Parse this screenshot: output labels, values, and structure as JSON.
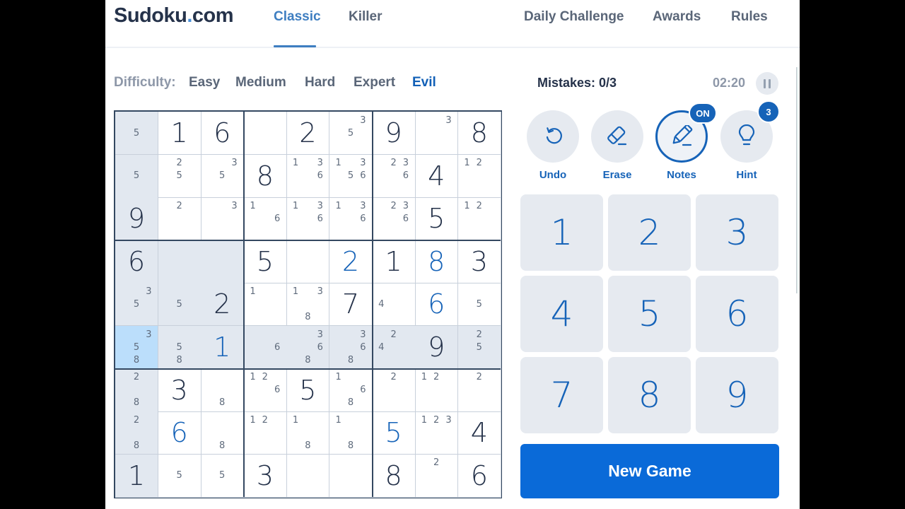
{
  "header": {
    "logo_main": "Sudoku",
    "logo_dot": ".",
    "logo_tld": "com",
    "nav": [
      {
        "label": "Classic",
        "active": true
      },
      {
        "label": "Killer",
        "active": false
      },
      {
        "label": "Daily Challenge",
        "active": false
      },
      {
        "label": "Awards",
        "active": false
      },
      {
        "label": "Rules",
        "active": false
      }
    ]
  },
  "difficulty": {
    "label": "Difficulty:",
    "options": [
      "Easy",
      "Medium",
      "Hard",
      "Expert",
      "Evil"
    ],
    "selected": "Evil"
  },
  "status": {
    "mistakes": "Mistakes: 0/3",
    "timer": "02:20",
    "pause_icon": "pause-icon"
  },
  "tools": [
    {
      "label": "Undo",
      "icon": "undo-icon"
    },
    {
      "label": "Erase",
      "icon": "eraser-icon"
    },
    {
      "label": "Notes",
      "icon": "pencil-icon",
      "badge": "ON"
    },
    {
      "label": "Hint",
      "icon": "lightbulb-icon",
      "badge": "3"
    }
  ],
  "numpad": [
    "1",
    "2",
    "3",
    "4",
    "5",
    "6",
    "7",
    "8",
    "9"
  ],
  "new_game_label": "New Game",
  "board": {
    "selected": [
      5,
      0
    ],
    "rows": [
      [
        {
          "n": [
            5
          ]
        },
        {
          "v": 1,
          "t": "g"
        },
        {
          "v": 6,
          "t": "g"
        },
        {},
        {
          "v": 2,
          "t": "g"
        },
        {
          "n": [
            3,
            5
          ]
        },
        {
          "v": 9,
          "t": "g"
        },
        {
          "n": [
            3
          ]
        },
        {
          "v": 8,
          "t": "g"
        }
      ],
      [
        {
          "n": [
            5
          ]
        },
        {
          "n": [
            2,
            5
          ]
        },
        {
          "n": [
            3,
            5
          ]
        },
        {
          "v": 8,
          "t": "g"
        },
        {
          "n": [
            1,
            3,
            6
          ]
        },
        {
          "n": [
            1,
            3,
            5,
            6
          ]
        },
        {
          "n": [
            2,
            3,
            6
          ]
        },
        {
          "v": 4,
          "t": "g"
        },
        {
          "n": [
            1,
            2
          ]
        }
      ],
      [
        {
          "v": 9,
          "t": "g"
        },
        {
          "n": [
            2
          ]
        },
        {
          "n": [
            3
          ]
        },
        {
          "n": [
            1,
            6
          ]
        },
        {
          "n": [
            1,
            3,
            6
          ]
        },
        {
          "n": [
            1,
            3,
            6
          ]
        },
        {
          "n": [
            2,
            3,
            6
          ]
        },
        {
          "v": 5,
          "t": "g"
        },
        {
          "n": [
            1,
            2
          ]
        }
      ],
      [
        {
          "v": 6,
          "t": "g"
        },
        {},
        {},
        {
          "v": 5,
          "t": "g"
        },
        {},
        {
          "v": 2,
          "t": "u"
        },
        {
          "v": 1,
          "t": "g"
        },
        {
          "v": 8,
          "t": "u"
        },
        {
          "v": 3,
          "t": "g"
        }
      ],
      [
        {
          "n": [
            3,
            5
          ]
        },
        {
          "n": [
            5
          ]
        },
        {
          "v": 2,
          "t": "g"
        },
        {
          "n": [
            1
          ]
        },
        {
          "n": [
            1,
            3,
            8
          ]
        },
        {
          "v": 7,
          "t": "g"
        },
        {
          "n": [
            4
          ]
        },
        {
          "v": 6,
          "t": "u"
        },
        {
          "n": [
            5
          ]
        }
      ],
      [
        {
          "n": [
            3,
            5,
            8
          ]
        },
        {
          "n": [
            5,
            8
          ]
        },
        {
          "v": 1,
          "t": "u"
        },
        {
          "n": [
            6
          ]
        },
        {
          "n": [
            3,
            6,
            8
          ]
        },
        {
          "n": [
            3,
            6,
            8
          ]
        },
        {
          "n": [
            2,
            4
          ]
        },
        {
          "v": 9,
          "t": "g"
        },
        {
          "n": [
            2,
            5
          ]
        }
      ],
      [
        {
          "n": [
            2,
            8
          ]
        },
        {
          "v": 3,
          "t": "g"
        },
        {
          "n": [
            8
          ]
        },
        {
          "n": [
            1,
            2,
            6
          ]
        },
        {
          "v": 5,
          "t": "g"
        },
        {
          "n": [
            1,
            6,
            8
          ]
        },
        {
          "n": [
            2
          ]
        },
        {
          "n": [
            1,
            2
          ]
        },
        {
          "n": [
            2
          ]
        }
      ],
      [
        {
          "n": [
            2,
            8
          ]
        },
        {
          "v": 6,
          "t": "u"
        },
        {
          "n": [
            8
          ]
        },
        {
          "n": [
            1,
            2
          ]
        },
        {
          "n": [
            1,
            8
          ]
        },
        {
          "n": [
            1,
            8
          ]
        },
        {
          "v": 5,
          "t": "u"
        },
        {
          "n": [
            1,
            2,
            3
          ]
        },
        {
          "v": 4,
          "t": "g"
        }
      ],
      [
        {
          "v": 1,
          "t": "g"
        },
        {
          "n": [
            5
          ]
        },
        {
          "n": [
            5
          ]
        },
        {
          "v": 3,
          "t": "g"
        },
        {},
        {},
        {
          "v": 8,
          "t": "g"
        },
        {
          "n": [
            2
          ]
        },
        {
          "v": 6,
          "t": "g"
        }
      ]
    ]
  },
  "colors": {
    "accent": "#1663b8",
    "given_digit": "#25324a",
    "highlight": "#e2e8f0",
    "selected": "#bbdefb",
    "new_game_bg": "#0a6ad8"
  }
}
